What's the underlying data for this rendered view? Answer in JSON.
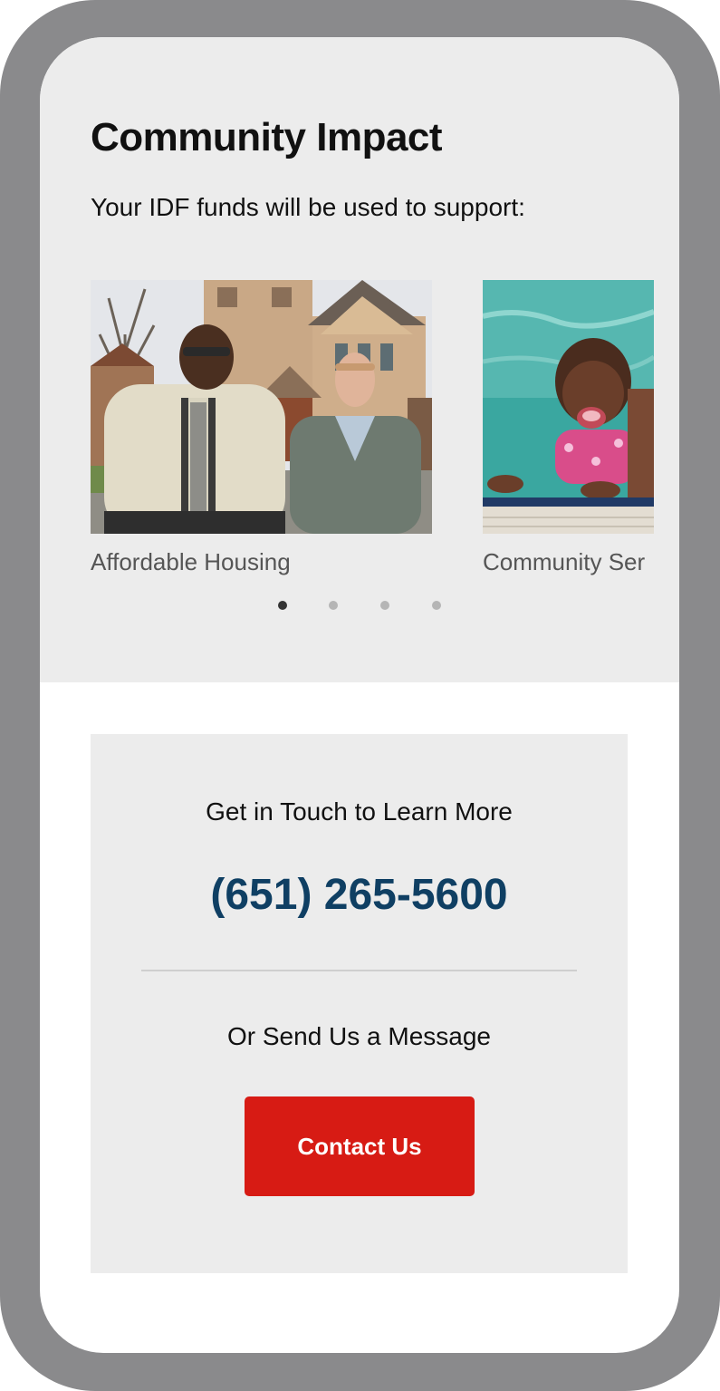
{
  "impact": {
    "title": "Community Impact",
    "subtitle": "Your IDF funds will be used to support:"
  },
  "carousel": {
    "slides": [
      {
        "caption": "Affordable Housing",
        "image": "photo-two-men-in-front-of-church"
      },
      {
        "caption": "Community Ser",
        "image": "photo-laughing-child-in-pool"
      }
    ],
    "dots_total": 4,
    "active_dot": 1
  },
  "contact": {
    "heading": "Get in Touch to Learn More",
    "phone": "(651) 265-5600",
    "message_prompt": "Or Send Us a Message",
    "button_label": "Contact Us",
    "colors": {
      "phone": "#0f3f63",
      "button": "#d71b14"
    }
  }
}
